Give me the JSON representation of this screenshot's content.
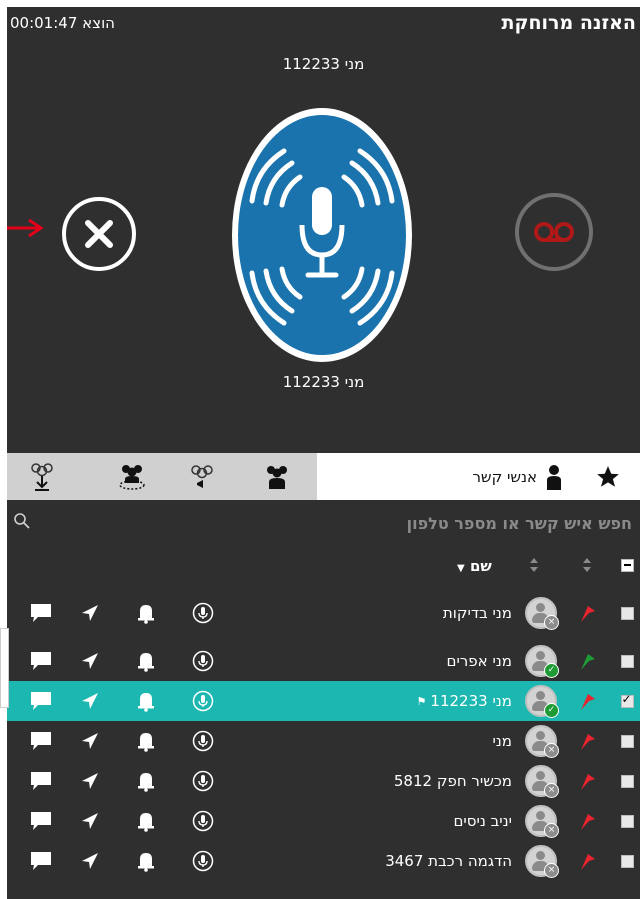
{
  "header": {
    "title": "האזנה מרוחקת",
    "timer_label": "הוצא 00:01:47"
  },
  "call": {
    "caller_top": "מני 112233",
    "caller_bottom": "מני 112233"
  },
  "colors": {
    "mic_blue": "#1a73ad",
    "teal_selected": "#1bb7b0",
    "flag_red": "#e8252e",
    "flag_green": "#1f9b35",
    "arrow_red": "#e3001b"
  },
  "icons": {
    "close": "x-icon",
    "mic": "microphone-icon",
    "voicemail": "voicemail-icon",
    "star": "star-icon",
    "contacts": "person-icon"
  },
  "tabs": {
    "contacts_label": "אנשי קשר"
  },
  "search": {
    "placeholder": "חפש איש קשר או מספר טלפון"
  },
  "table": {
    "name_header": "שם"
  },
  "contacts": [
    {
      "name": "מני בדיקות",
      "status": "offline",
      "flag": "red",
      "checked": false,
      "selected": false
    },
    {
      "name": "מני אפרים",
      "status": "online",
      "flag": "green",
      "checked": false,
      "selected": false
    },
    {
      "name": "מני 112233",
      "status": "online",
      "flag": "red",
      "checked": true,
      "selected": true
    },
    {
      "name": "מני",
      "status": "offline",
      "flag": "red",
      "checked": false,
      "selected": false
    },
    {
      "name": "מכשיר חפק 5812",
      "status": "offline",
      "flag": "red",
      "checked": false,
      "selected": false
    },
    {
      "name": "יניב ניסים",
      "status": "offline",
      "flag": "red",
      "checked": false,
      "selected": false
    },
    {
      "name": "הדגמה רכבת 3467",
      "status": "offline",
      "flag": "red",
      "checked": false,
      "selected": false
    }
  ]
}
